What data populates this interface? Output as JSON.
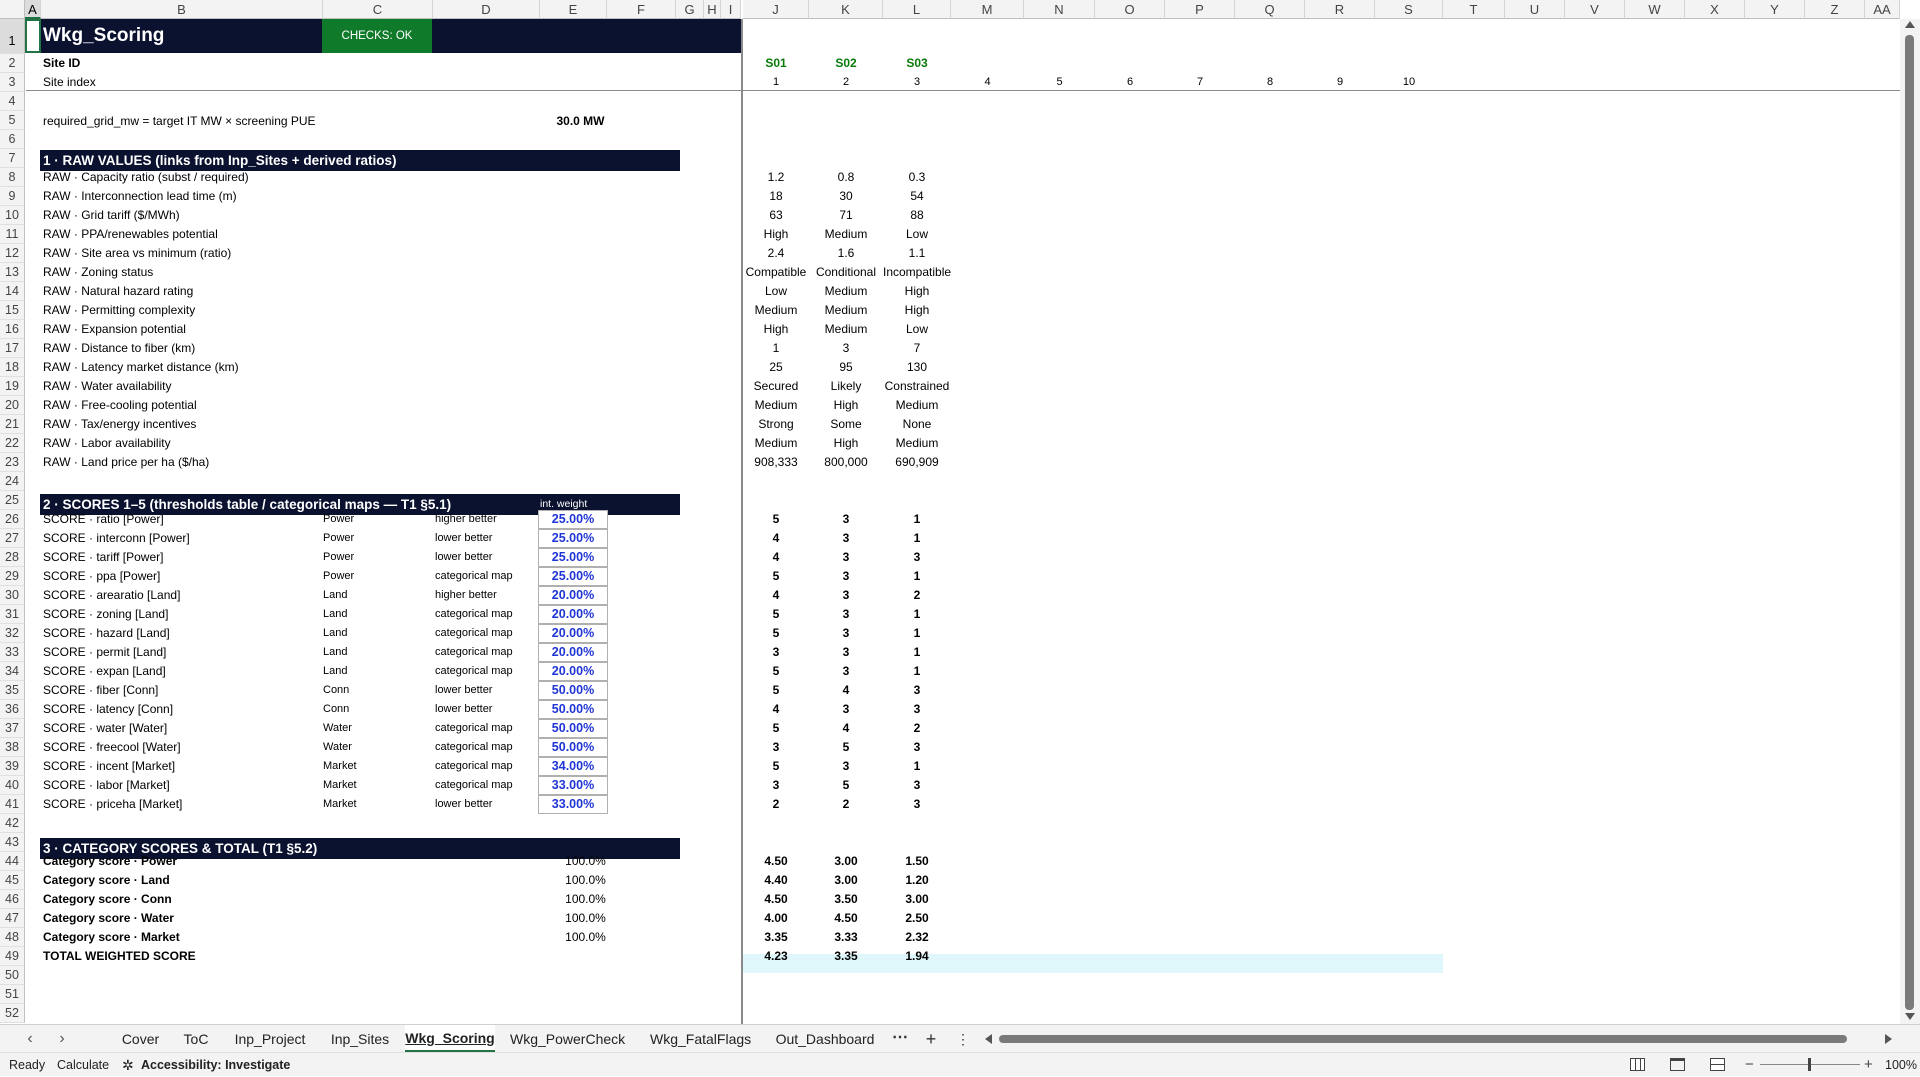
{
  "columns": [
    "A",
    "B",
    "C",
    "D",
    "E",
    "F",
    "G",
    "H",
    "I",
    "J",
    "K",
    "L",
    "M",
    "N",
    "O",
    "P",
    "Q",
    "R",
    "S",
    "T",
    "U",
    "V",
    "W",
    "X",
    "Y",
    "Z",
    "AA"
  ],
  "selected_column": "A",
  "selected_row": 1,
  "sheet_title": "Wkg_Scoring",
  "checks_label": "CHECKS: OK",
  "site_id_label": "Site ID",
  "site_ids": [
    "S01",
    "S02",
    "S03"
  ],
  "site_index_label": "Site index",
  "site_indices": [
    "1",
    "2",
    "3",
    "4",
    "5",
    "6",
    "7",
    "8",
    "9",
    "10"
  ],
  "formula_note": "required_grid_mw = target IT MW × screening PUE",
  "required_mw": "30.0 MW",
  "section1_title": "1 · RAW VALUES (links from Inp_Sites + derived ratios)",
  "raw_rows": [
    {
      "label": "RAW · Capacity ratio (subst / required)",
      "values": [
        "1.2",
        "0.8",
        "0.3"
      ]
    },
    {
      "label": "RAW · Interconnection lead time (m)",
      "values": [
        "18",
        "30",
        "54"
      ]
    },
    {
      "label": "RAW · Grid tariff ($/MWh)",
      "values": [
        "63",
        "71",
        "88"
      ]
    },
    {
      "label": "RAW · PPA/renewables potential",
      "values": [
        "High",
        "Medium",
        "Low"
      ]
    },
    {
      "label": "RAW · Site area vs minimum (ratio)",
      "values": [
        "2.4",
        "1.6",
        "1.1"
      ]
    },
    {
      "label": "RAW · Zoning status",
      "values": [
        "Compatible",
        "Conditional",
        "Incompatible"
      ]
    },
    {
      "label": "RAW · Natural hazard rating",
      "values": [
        "Low",
        "Medium",
        "High"
      ]
    },
    {
      "label": "RAW · Permitting complexity",
      "values": [
        "Medium",
        "Medium",
        "High"
      ]
    },
    {
      "label": "RAW · Expansion potential",
      "values": [
        "High",
        "Medium",
        "Low"
      ]
    },
    {
      "label": "RAW · Distance to fiber (km)",
      "values": [
        "1",
        "3",
        "7"
      ]
    },
    {
      "label": "RAW · Latency market distance (km)",
      "values": [
        "25",
        "95",
        "130"
      ]
    },
    {
      "label": "RAW · Water availability",
      "values": [
        "Secured",
        "Likely",
        "Constrained"
      ]
    },
    {
      "label": "RAW · Free-cooling potential",
      "values": [
        "Medium",
        "High",
        "Medium"
      ]
    },
    {
      "label": "RAW · Tax/energy incentives",
      "values": [
        "Strong",
        "Some",
        "None"
      ]
    },
    {
      "label": "RAW · Labor availability",
      "values": [
        "Medium",
        "High",
        "Medium"
      ]
    },
    {
      "label": "RAW · Land price per ha ($/ha)",
      "values": [
        "908,333",
        "800,000",
        "690,909"
      ]
    }
  ],
  "section2_title": "2 · SCORES 1–5 (thresholds table / categorical maps — T1 §5.1)",
  "int_weight_label": "int. weight",
  "score_rows": [
    {
      "label": "SCORE · ratio [Power]",
      "cat": "Power",
      "dir": "higher better",
      "weight": "25.00%",
      "values": [
        "5",
        "3",
        "1"
      ]
    },
    {
      "label": "SCORE · interconn [Power]",
      "cat": "Power",
      "dir": "lower better",
      "weight": "25.00%",
      "values": [
        "4",
        "3",
        "1"
      ]
    },
    {
      "label": "SCORE · tariff [Power]",
      "cat": "Power",
      "dir": "lower better",
      "weight": "25.00%",
      "values": [
        "4",
        "3",
        "3"
      ]
    },
    {
      "label": "SCORE · ppa [Power]",
      "cat": "Power",
      "dir": "categorical map",
      "weight": "25.00%",
      "values": [
        "5",
        "3",
        "1"
      ]
    },
    {
      "label": "SCORE · arearatio [Land]",
      "cat": "Land",
      "dir": "higher better",
      "weight": "20.00%",
      "values": [
        "4",
        "3",
        "2"
      ]
    },
    {
      "label": "SCORE · zoning [Land]",
      "cat": "Land",
      "dir": "categorical map",
      "weight": "20.00%",
      "values": [
        "5",
        "3",
        "1"
      ]
    },
    {
      "label": "SCORE · hazard [Land]",
      "cat": "Land",
      "dir": "categorical map",
      "weight": "20.00%",
      "values": [
        "5",
        "3",
        "1"
      ]
    },
    {
      "label": "SCORE · permit [Land]",
      "cat": "Land",
      "dir": "categorical map",
      "weight": "20.00%",
      "values": [
        "3",
        "3",
        "1"
      ]
    },
    {
      "label": "SCORE · expan [Land]",
      "cat": "Land",
      "dir": "categorical map",
      "weight": "20.00%",
      "values": [
        "5",
        "3",
        "1"
      ]
    },
    {
      "label": "SCORE · fiber [Conn]",
      "cat": "Conn",
      "dir": "lower better",
      "weight": "50.00%",
      "values": [
        "5",
        "4",
        "3"
      ]
    },
    {
      "label": "SCORE · latency [Conn]",
      "cat": "Conn",
      "dir": "lower better",
      "weight": "50.00%",
      "values": [
        "4",
        "3",
        "3"
      ]
    },
    {
      "label": "SCORE · water [Water]",
      "cat": "Water",
      "dir": "categorical map",
      "weight": "50.00%",
      "values": [
        "5",
        "4",
        "2"
      ]
    },
    {
      "label": "SCORE · freecool [Water]",
      "cat": "Water",
      "dir": "categorical map",
      "weight": "50.00%",
      "values": [
        "3",
        "5",
        "3"
      ]
    },
    {
      "label": "SCORE · incent [Market]",
      "cat": "Market",
      "dir": "categorical map",
      "weight": "34.00%",
      "values": [
        "5",
        "3",
        "1"
      ]
    },
    {
      "label": "SCORE · labor [Market]",
      "cat": "Market",
      "dir": "categorical map",
      "weight": "33.00%",
      "values": [
        "3",
        "5",
        "3"
      ]
    },
    {
      "label": "SCORE · priceha [Market]",
      "cat": "Market",
      "dir": "lower better",
      "weight": "33.00%",
      "values": [
        "2",
        "2",
        "3"
      ]
    }
  ],
  "section3_title": "3 · CATEGORY SCORES & TOTAL (T1 §5.2)",
  "category_rows": [
    {
      "label": "Category score · Power",
      "pct": "100.0%",
      "values": [
        "4.50",
        "3.00",
        "1.50"
      ]
    },
    {
      "label": "Category score · Land",
      "pct": "100.0%",
      "values": [
        "4.40",
        "3.00",
        "1.20"
      ]
    },
    {
      "label": "Category score · Conn",
      "pct": "100.0%",
      "values": [
        "4.50",
        "3.50",
        "3.00"
      ]
    },
    {
      "label": "Category score · Water",
      "pct": "100.0%",
      "values": [
        "4.00",
        "4.50",
        "2.50"
      ]
    },
    {
      "label": "Category score · Market",
      "pct": "100.0%",
      "values": [
        "3.35",
        "3.33",
        "2.32"
      ]
    }
  ],
  "total_row": {
    "label": "TOTAL WEIGHTED SCORE",
    "values": [
      "4.23",
      "3.35",
      "1.94"
    ]
  },
  "sheet_tabs": [
    "Cover",
    "ToC",
    "Inp_Project",
    "Inp_Sites",
    "Wkg_Scoring",
    "Wkg_PowerCheck",
    "Wkg_FatalFlags",
    "Out_Dashboard"
  ],
  "active_tab": "Wkg_Scoring",
  "status": {
    "ready": "Ready",
    "calculate": "Calculate",
    "accessibility": "Accessibility: Investigate",
    "zoom": "100%"
  },
  "colors": {
    "navy": "#0a1230",
    "green_badge": "#0e7a2a",
    "site_id_green": "#0a7a0a",
    "weight_blue": "#1f35d6",
    "total_band": "#dff7fb",
    "excel_green": "#217346"
  }
}
